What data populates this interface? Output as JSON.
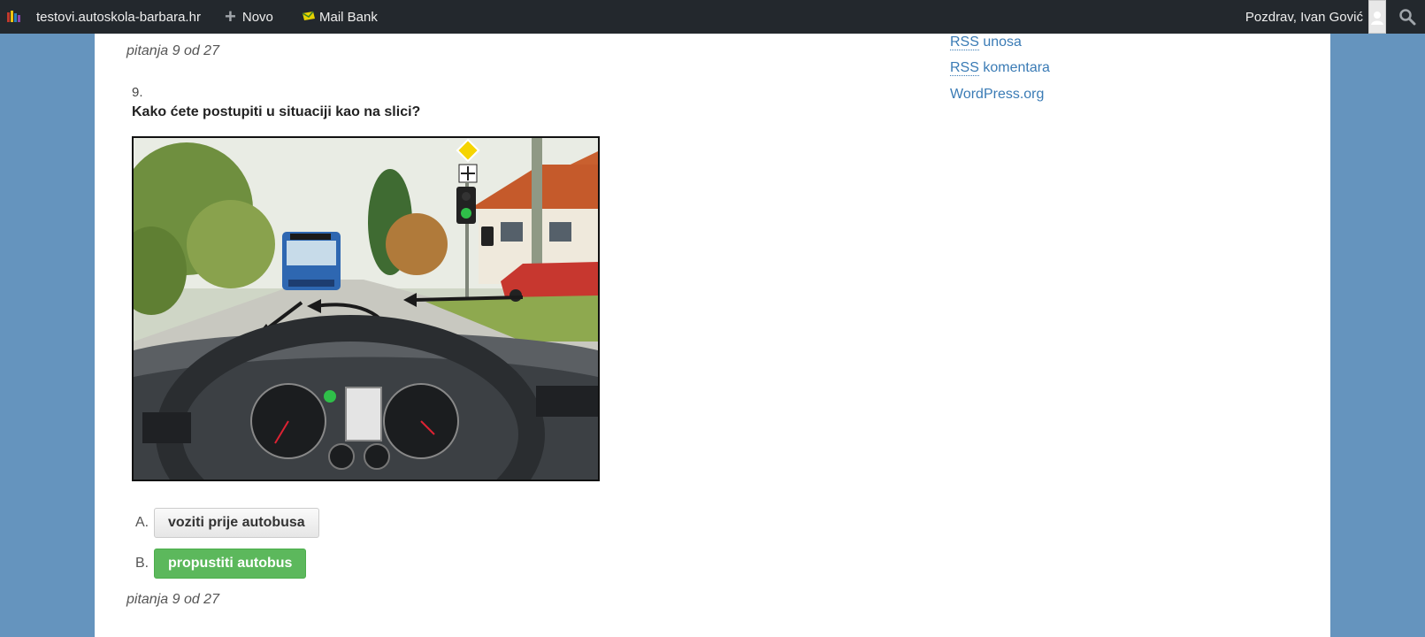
{
  "adminbar": {
    "site_name": "testovi.autoskola-barbara.hr",
    "new_label": "Novo",
    "mail_label": "Mail Bank",
    "greeting": "Pozdrav, Ivan Gović"
  },
  "quiz": {
    "pager_top": "pitanja 9 od 27",
    "pager_bottom": "pitanja 9 od 27",
    "question_number": "9.",
    "question_text": "Kako ćete postupiti u situaciji kao na slici?",
    "answers": [
      {
        "letter": "A.",
        "label": "voziti prije autobusa",
        "state": "neutral"
      },
      {
        "letter": "B.",
        "label": "propustiti autobus",
        "state": "correct"
      }
    ]
  },
  "sidebar": {
    "rss_abbr": "RSS",
    "rss_posts_label": "unosa",
    "rss_comments_label": "komentara",
    "wp_label": "WordPress.org"
  },
  "colors": {
    "adminbar_bg": "#23282d",
    "page_bg": "#6594be",
    "correct_green": "#5cb85c",
    "link_blue": "#3a7bb5"
  }
}
